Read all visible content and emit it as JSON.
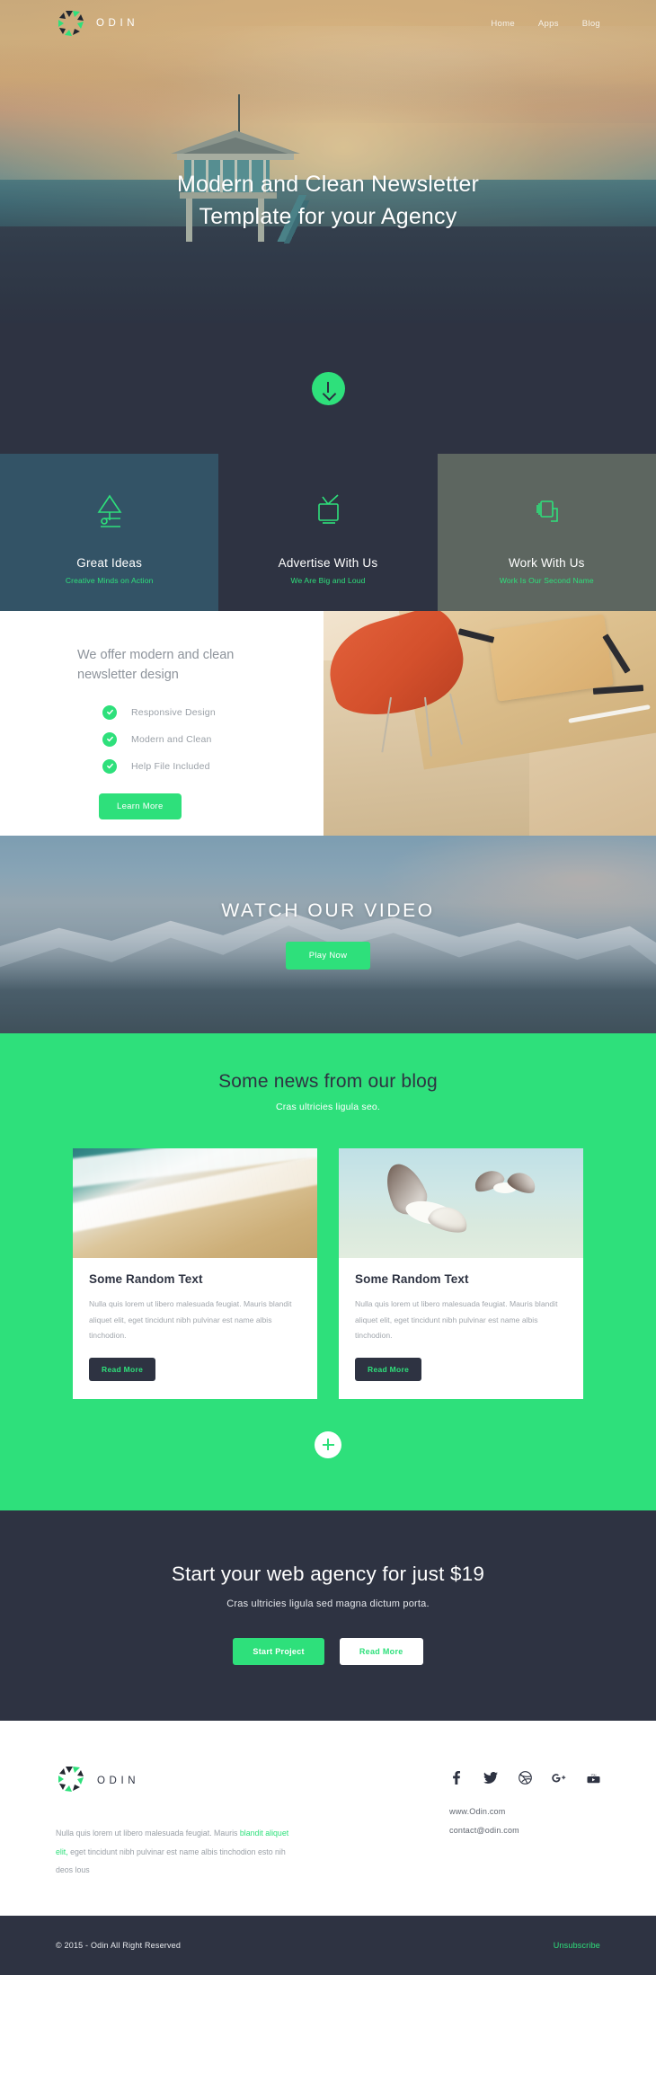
{
  "brand": {
    "name": "ODIN",
    "logo_icon": "odin-triangles-logo",
    "accent_color": "#2ee07b",
    "dark_color": "#2e3342"
  },
  "nav": {
    "items": [
      {
        "label": "Home"
      },
      {
        "label": "Apps"
      },
      {
        "label": "Blog"
      }
    ]
  },
  "hero": {
    "title_line1": "Modern and Clean Newsletter",
    "title_line2": "Template for your Agency",
    "scroll_icon": "arrow-down-icon"
  },
  "features": [
    {
      "icon": "lamp-icon",
      "title": "Great Ideas",
      "subtitle": "Creative Minds on Action",
      "bg": "#335366"
    },
    {
      "icon": "tv-icon",
      "title": "Advertise With Us",
      "subtitle": "We Are Big and Loud",
      "bg": "#2e3342"
    },
    {
      "icon": "projector-icon",
      "title": "Work With Us",
      "subtitle": "Work Is Our Second Name",
      "bg": "#5d6660"
    }
  ],
  "offer": {
    "heading": "We offer modern and clean newsletter design",
    "items": [
      {
        "label": "Responsive Design"
      },
      {
        "label": "Modern and Clean"
      },
      {
        "label": "Help File Included"
      }
    ],
    "button": "Learn More",
    "image_alt": "desk-with-orange-chair-photo"
  },
  "video": {
    "title": "WATCH OUR VIDEO",
    "button": "Play Now",
    "image_alt": "snowy-mountain-photo"
  },
  "blog": {
    "heading": "Some news from our blog",
    "subheading": "Cras ultricies ligula seo.",
    "cards": [
      {
        "image_alt": "beach-waves-photo",
        "title": "Some Random Text",
        "body": "Nulla quis lorem ut libero malesuada feugiat. Mauris blandit aliquet elit, eget tincidunt nibh pulvinar est name albis tinchodion.",
        "button": "Read More"
      },
      {
        "image_alt": "seagulls-flying-photo",
        "title": "Some Random Text",
        "body": "Nulla quis lorem ut libero malesuada feugiat. Mauris blandit aliquet elit, eget tincidunt nibh pulvinar est name albis tinchodion.",
        "button": "Read More"
      }
    ],
    "load_more_icon": "plus-icon"
  },
  "cta": {
    "heading": "Start your web agency for just $19",
    "subheading": "Cras ultricies ligula sed magna dictum porta.",
    "primary_button": "Start Project",
    "secondary_button": "Read More"
  },
  "footer": {
    "brand_name": "ODIN",
    "about_part1": "Nulla quis lorem ut libero malesuada feugiat. Mauris ",
    "about_link": "blandit aliquet elit,",
    "about_part2": " eget tincidunt nibh pulvinar est name albis tinchodion esto nih deos lous",
    "socials": [
      {
        "icon": "facebook-icon"
      },
      {
        "icon": "twitter-icon"
      },
      {
        "icon": "dribbble-icon"
      },
      {
        "icon": "google-plus-icon"
      },
      {
        "icon": "youtube-icon"
      }
    ],
    "links": [
      {
        "label": "www.Odin.com"
      },
      {
        "label": "contact@odin.com"
      }
    ]
  },
  "bottombar": {
    "copyright": "© 2015 - Odin All Right Reserved",
    "unsubscribe": "Unsubscribe"
  }
}
